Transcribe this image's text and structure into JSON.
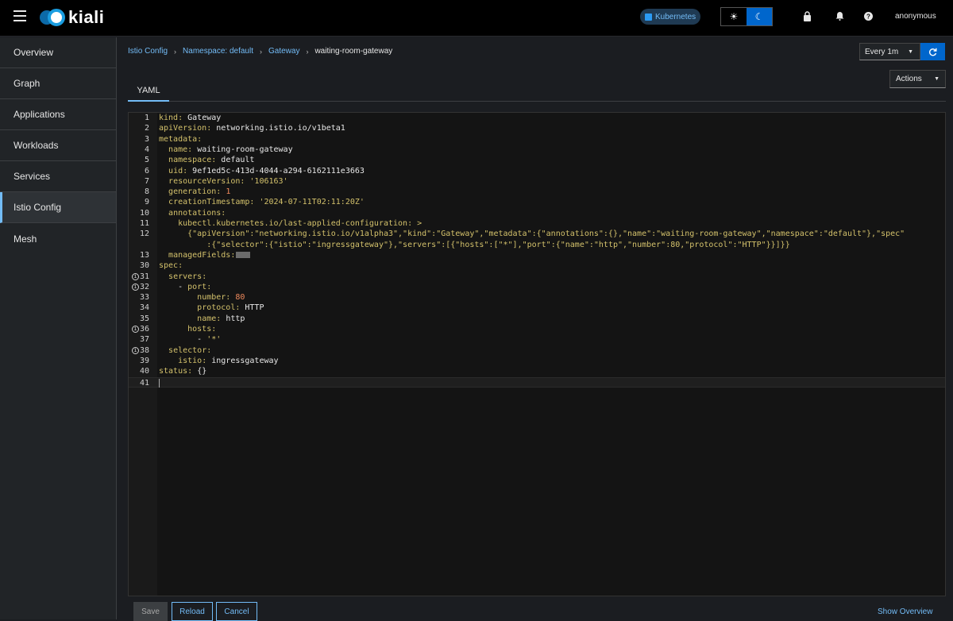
{
  "header": {
    "logo_text": "kiali",
    "cluster_badge": "Kubernetes",
    "user": "anonymous"
  },
  "sidebar": {
    "items": [
      {
        "label": "Overview"
      },
      {
        "label": "Graph"
      },
      {
        "label": "Applications"
      },
      {
        "label": "Workloads"
      },
      {
        "label": "Services"
      },
      {
        "label": "Istio Config",
        "active": true
      },
      {
        "label": "Mesh"
      }
    ]
  },
  "breadcrumb": {
    "items": [
      "Istio Config",
      "Namespace: default",
      "Gateway"
    ],
    "current": "waiting-room-gateway"
  },
  "refresh": {
    "interval": "Every 1m"
  },
  "actions_label": "Actions",
  "tabs": [
    {
      "label": "YAML"
    }
  ],
  "editor": {
    "lines": [
      {
        "n": "1",
        "key": "kind",
        "indent": "",
        "val": "Gateway"
      },
      {
        "n": "2",
        "key": "apiVersion",
        "indent": "",
        "val": "networking.istio.io/v1beta1"
      },
      {
        "n": "3",
        "key": "metadata",
        "indent": "",
        "val": ""
      },
      {
        "n": "4",
        "key": "name",
        "indent": "  ",
        "val": "waiting-room-gateway"
      },
      {
        "n": "5",
        "key": "namespace",
        "indent": "  ",
        "val": "default"
      },
      {
        "n": "6",
        "key": "uid",
        "indent": "  ",
        "val": "9ef1ed5c-413d-4044-a294-6162111e3663"
      },
      {
        "n": "7",
        "key": "resourceVersion",
        "indent": "  ",
        "val": "'106163'",
        "str": true
      },
      {
        "n": "8",
        "key": "generation",
        "indent": "  ",
        "val": "1",
        "num": true
      },
      {
        "n": "9",
        "key": "creationTimestamp",
        "indent": "  ",
        "val": "'2024-07-11T02:11:20Z'",
        "str": true
      },
      {
        "n": "10",
        "key": "annotations",
        "indent": "  ",
        "val": ""
      },
      {
        "n": "11",
        "key": "kubectl.kubernetes.io/last-applied-configuration",
        "indent": "    ",
        "val": ">",
        "str": true
      },
      {
        "n": "12",
        "key": "",
        "indent": "      ",
        "val": "{\"apiVersion\":\"networking.istio.io/v1alpha3\",\"kind\":\"Gateway\",\"metadata\":{\"annotations\":{},\"name\":\"waiting-room-gateway\",\"namespace\":\"default\"},\"spec\"",
        "str": true
      },
      {
        "n": "",
        "key": "",
        "indent": "          ",
        "val": ":{\"selector\":{\"istio\":\"ingressgateway\"},\"servers\":[{\"hosts\":[\"*\"],\"port\":{\"name\":\"http\",\"number\":80,\"protocol\":\"HTTP\"}}]}}",
        "str": true
      },
      {
        "n": "13",
        "key": "managedFields",
        "indent": "  ",
        "val": "",
        "folded": true
      },
      {
        "n": "30",
        "key": "spec",
        "indent": "",
        "val": ""
      },
      {
        "n": "31",
        "key": "servers",
        "indent": "  ",
        "val": "",
        "marker": true
      },
      {
        "n": "32",
        "key": "port",
        "indent": "    - ",
        "val": "",
        "marker": true
      },
      {
        "n": "33",
        "key": "number",
        "indent": "        ",
        "val": "80",
        "num": true
      },
      {
        "n": "34",
        "key": "protocol",
        "indent": "        ",
        "val": "HTTP"
      },
      {
        "n": "35",
        "key": "name",
        "indent": "        ",
        "val": "http"
      },
      {
        "n": "36",
        "key": "hosts",
        "indent": "      ",
        "val": "",
        "marker": true
      },
      {
        "n": "37",
        "key": "",
        "indent": "        - ",
        "val": "'*'",
        "str": true
      },
      {
        "n": "38",
        "key": "selector",
        "indent": "  ",
        "val": "",
        "marker": true
      },
      {
        "n": "39",
        "key": "istio",
        "indent": "    ",
        "val": "ingressgateway"
      },
      {
        "n": "40",
        "key": "status",
        "indent": "",
        "val": "{}"
      },
      {
        "n": "41",
        "key": "",
        "indent": "",
        "val": "",
        "cursor": true
      }
    ]
  },
  "footer": {
    "save": "Save",
    "reload": "Reload",
    "cancel": "Cancel",
    "show_overview": "Show Overview"
  }
}
